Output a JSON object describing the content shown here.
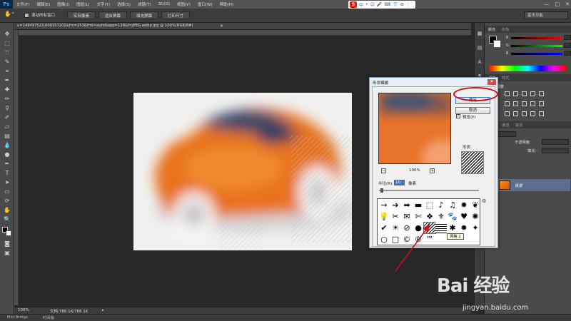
{
  "app": {
    "logo": "Ps"
  },
  "menu": [
    "文件(F)",
    "编辑(E)",
    "图像(I)",
    "图层(L)",
    "文字(Y)",
    "选择(S)",
    "滤镜(T)",
    "3D(D)",
    "视图(V)",
    "窗口(W)",
    "帮助(H)"
  ],
  "window_controls": {
    "minimize": "—",
    "maximize": "□",
    "close": "✕"
  },
  "ime": {
    "logo": "S",
    "items": [
      "中",
      "•",
      "☺",
      "🎤",
      "⌨",
      "👕",
      "⚙",
      "⋮"
    ]
  },
  "options_bar": {
    "scroll_all_label": "滚动所有窗口",
    "buttons": [
      "实际像素",
      "适合屏幕",
      "填充屏幕",
      "打印尺寸"
    ],
    "workspace": "基本功能"
  },
  "document": {
    "tab_title": "u=148497523,608357201&fm=253&fmt=auto&app=138&f=JPEG.webp.jpg @ 100%(RGB/8#)",
    "close": "×"
  },
  "status": {
    "zoom": "100%",
    "doc_size": "文档:788.1K/788.1K"
  },
  "bottom_tabs": [
    "Mini Bridge",
    "时间轴"
  ],
  "panels": {
    "color_tabs": [
      "颜色",
      "色板"
    ],
    "adjust_tabs": [
      "调整",
      "样式"
    ],
    "adjust_label": "添加调整",
    "layer_tabs": [
      "图层",
      "通道",
      "路径"
    ],
    "opacity_label": "不透明度:",
    "fill_label": "填充:",
    "layer_name": "背景",
    "slider_letters": [
      "R",
      "G",
      "B"
    ]
  },
  "dialog": {
    "title": "形状模糊",
    "ok": "确定",
    "cancel": "取消",
    "preview_label": "预览(P)",
    "preview_checked": "✓",
    "zoom": "100%",
    "zoom_minus": "−",
    "zoom_plus": "+",
    "radius_label": "半径(R):",
    "radius_value": "10",
    "radius_unit": "像素",
    "shape_label": "形状:",
    "tooltip": "网格 2",
    "close": "✕"
  },
  "shapes": [
    "→",
    "➔",
    "➡",
    "▬",
    "⬚",
    "♪",
    "♫",
    "✸",
    "❦",
    "💡",
    "✂",
    "✉",
    "✄",
    "❖",
    "⚜",
    "🐾",
    "♥",
    "✺",
    "✔",
    "☀",
    "⊘",
    "●",
    "▦",
    "▦",
    "✱",
    "✹",
    "✦",
    "○",
    "□",
    "©",
    "®",
    "™",
    "",
    "",
    "",
    ""
  ],
  "watermark": {
    "main": "Bai 经验",
    "sub": "jingyan.baidu.com"
  },
  "colors": {
    "orange": "#e8732a",
    "selection": "#3a76d6",
    "annotation": "#c3101a"
  }
}
